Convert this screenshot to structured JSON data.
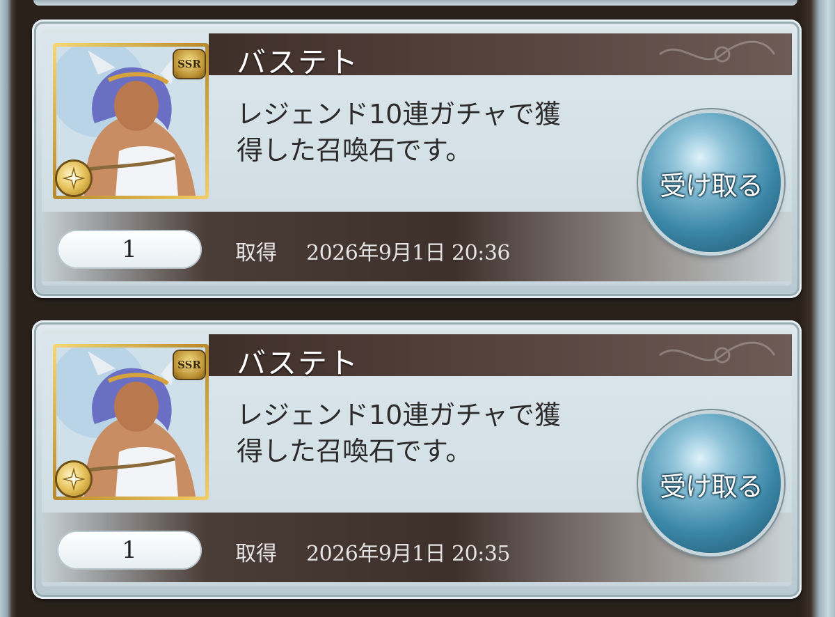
{
  "items": [
    {
      "name": "バステト",
      "rarity": "SSR",
      "description_line1": "レジェンド10連ガチャで獲",
      "description_line2": "得した召喚石です。",
      "quantity": "1",
      "acquired_label": "取得",
      "acquired_datetime": "2026年9月1日 20:36",
      "receive_label": "受け取る"
    },
    {
      "name": "バステト",
      "rarity": "SSR",
      "description_line1": "レジェンド10連ガチャで獲",
      "description_line2": "得した召喚石です。",
      "quantity": "1",
      "acquired_label": "取得",
      "acquired_datetime": "2026年9月1日 20:35",
      "receive_label": "受け取る"
    }
  ],
  "icons": {
    "portrait": "summon-portrait-icon",
    "rarity": "ssr-badge-icon",
    "element": "light-element-icon"
  },
  "colors": {
    "name_bar": "#4a3832",
    "receive_button": "#3b87a8",
    "card_background": "#dbe6ec"
  }
}
